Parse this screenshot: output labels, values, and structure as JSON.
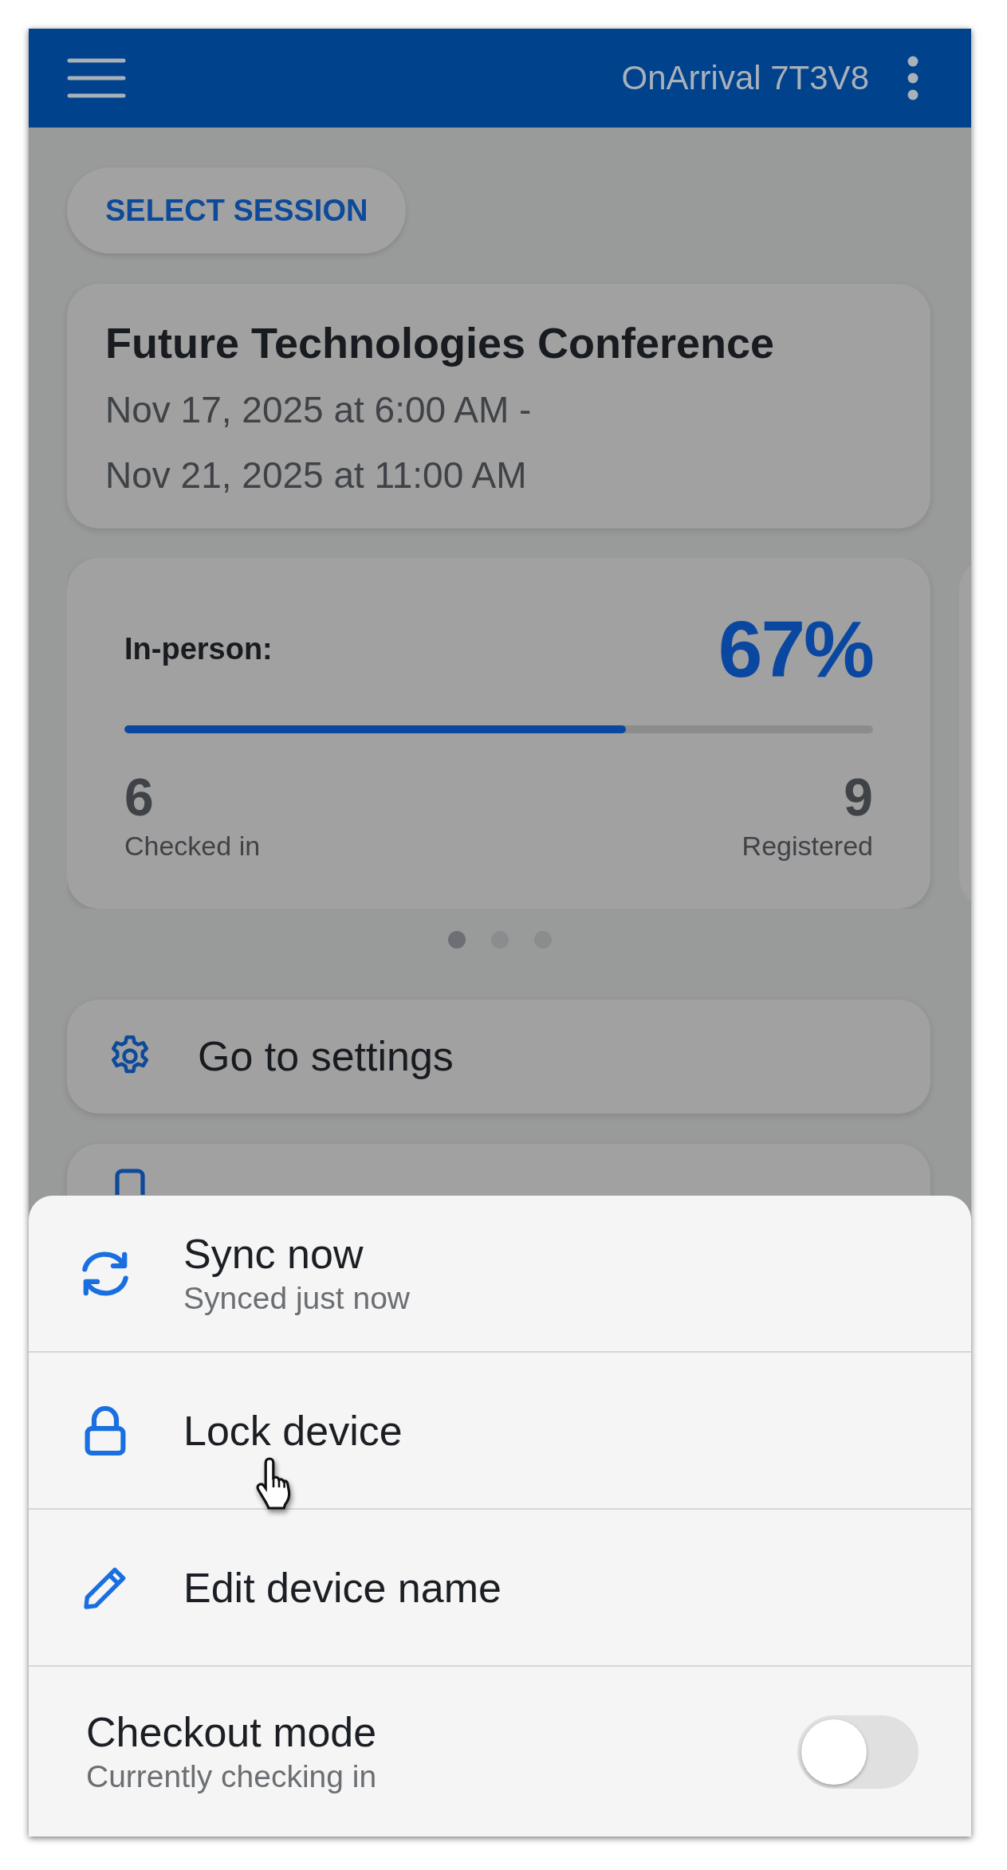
{
  "app_bar": {
    "title": "OnArrival 7T3V8"
  },
  "select_session": {
    "label": "SELECT SESSION"
  },
  "event": {
    "name": "Future Technologies Conference",
    "start": "Nov 17, 2025 at 6:00 AM -",
    "end": "Nov 21, 2025 at 11:00 AM"
  },
  "stats_cards": [
    {
      "label": "In-person:",
      "percent": "67%",
      "level": 0.67,
      "checked_in": "6",
      "checked_in_label": "Checked in",
      "registered": "9",
      "registered_label": "Registered"
    }
  ],
  "pager_dots": [
    {
      "selected": true
    },
    {
      "selected": false
    },
    {
      "selected": false
    }
  ],
  "actions": [
    {
      "kind": "settings",
      "label": "Go to settings"
    },
    {
      "kind": "device"
    }
  ],
  "sheet": {
    "items": [
      {
        "kind": "sync",
        "label": "Sync now",
        "subtitle": "Synced just now"
      },
      {
        "kind": "lock",
        "label": "Lock device"
      },
      {
        "kind": "edit",
        "label": "Edit device name"
      },
      {
        "kind": "toggle",
        "label": "Checkout mode",
        "subtitle": "Currently checking in",
        "on": false
      }
    ]
  }
}
